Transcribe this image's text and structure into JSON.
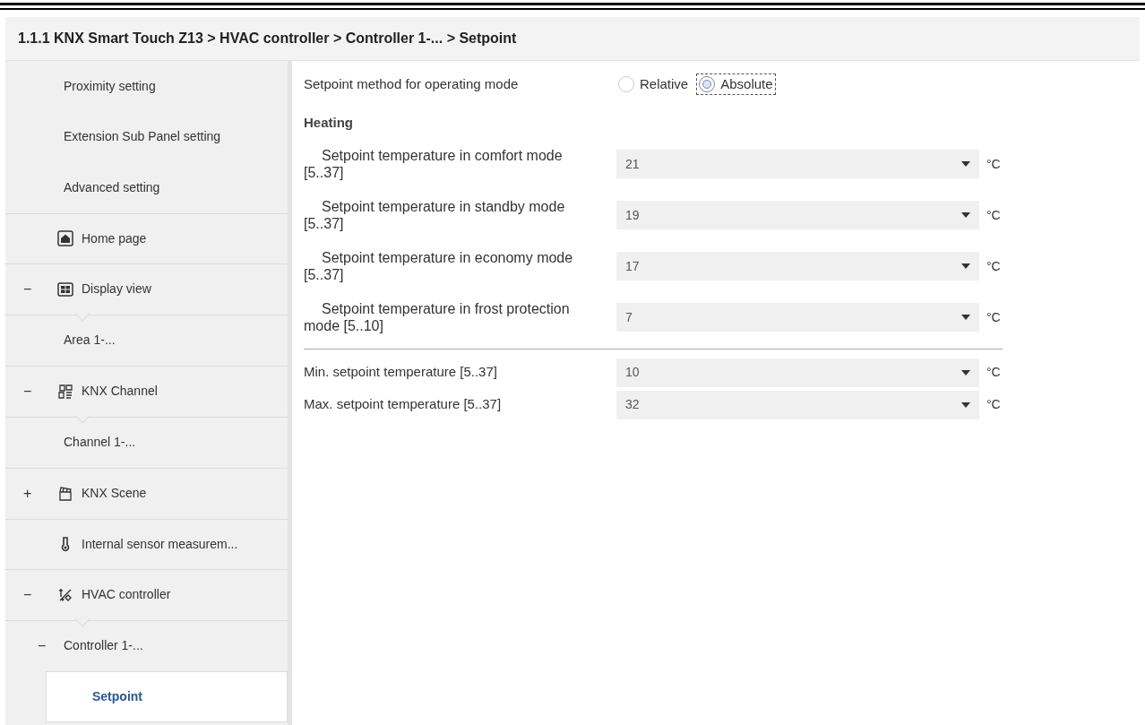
{
  "title": "1.1.1 KNX Smart Touch Z13 > HVAC controller > Controller 1-... > Setpoint",
  "sidebar": {
    "items": [
      {
        "label": "Proximity setting",
        "selected": false
      },
      {
        "label": "Extension Sub Panel setting",
        "selected": false
      },
      {
        "label": "Advanced setting",
        "selected": false
      },
      {
        "label": "Home page",
        "kind": "home",
        "selected": false
      },
      {
        "label": "Display view",
        "kind": "grid",
        "expander": "−",
        "selected": false,
        "children": [
          {
            "label": "Area 1-...",
            "selected": false
          }
        ]
      },
      {
        "label": "KNX Channel",
        "kind": "channel",
        "expander": "−",
        "selected": false,
        "children": [
          {
            "label": "Channel 1-...",
            "selected": false
          }
        ]
      },
      {
        "label": "KNX Scene",
        "kind": "scene",
        "expander": "+",
        "selected": false
      },
      {
        "label": "Internal sensor measurem...",
        "kind": "thermometer",
        "selected": false
      },
      {
        "label": "HVAC controller",
        "kind": "hvac",
        "expander": "−",
        "selected": false,
        "children": [
          {
            "label": "Controller 1-...",
            "expander": "−",
            "selected": false,
            "children": [
              {
                "label": "Setpoint",
                "selected": true
              }
            ]
          }
        ]
      }
    ]
  },
  "method": {
    "label": "Setpoint method for operating mode",
    "options": [
      {
        "label": "Relative",
        "selected": false,
        "focused": false
      },
      {
        "label": "Absolute",
        "selected": true,
        "focused": true
      }
    ]
  },
  "heading": "Heating",
  "heating_rows": [
    {
      "label": "Setpoint temperature in comfort mode [5..37]",
      "value": "21",
      "unit": "°C"
    },
    {
      "label": "Setpoint temperature in standby mode [5..37]",
      "value": "19",
      "unit": "°C"
    },
    {
      "label": "Setpoint temperature in economy mode [5..37]",
      "value": "17",
      "unit": "°C"
    },
    {
      "label": "Setpoint temperature in frost protection mode [5..10]",
      "value": "7",
      "unit": "°C"
    }
  ],
  "limit_rows": [
    {
      "label": "Min. setpoint temperature [5..37]",
      "value": "10",
      "unit": "°C"
    },
    {
      "label": "Max. setpoint temperature [5..37]",
      "value": "32",
      "unit": "°C"
    }
  ]
}
